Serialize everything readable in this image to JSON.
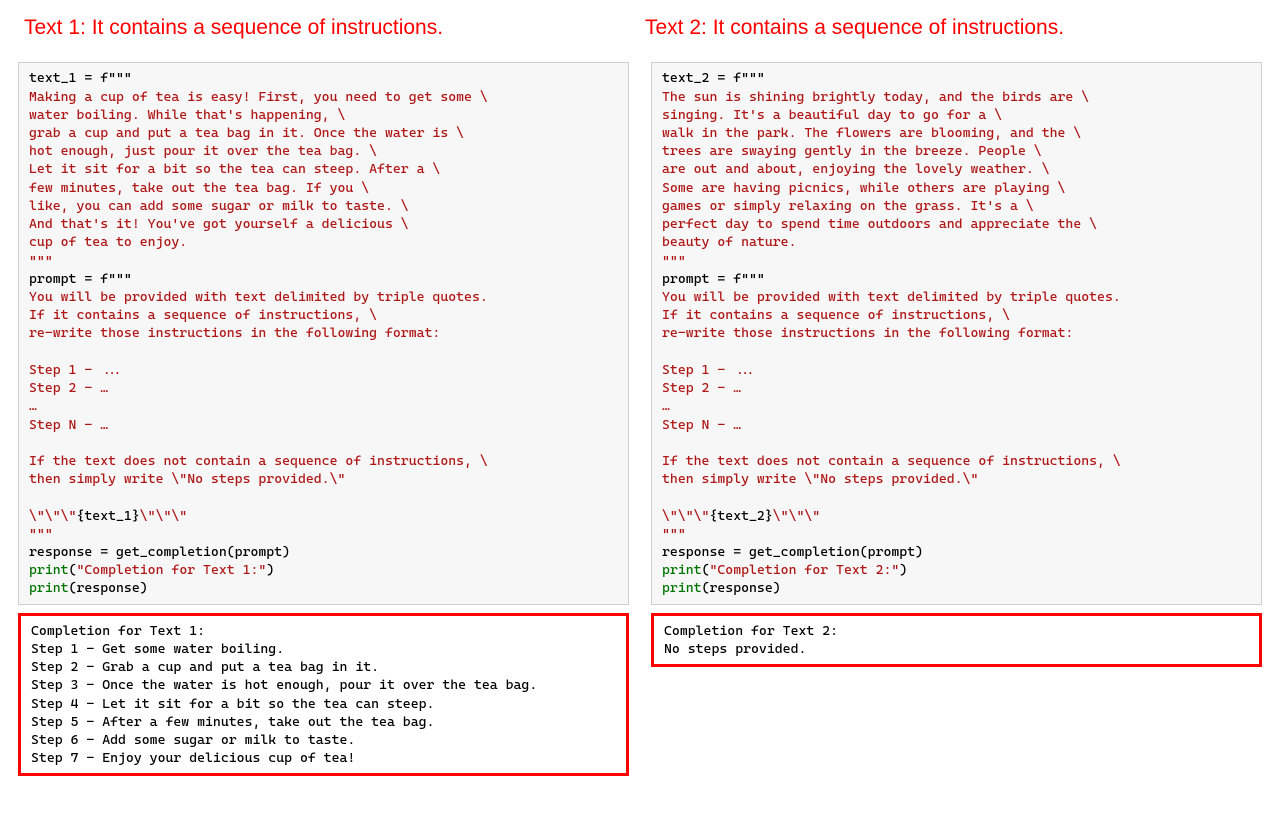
{
  "headers": {
    "left": "Text 1: It contains a sequence of instructions.",
    "right": "Text 2: It contains a sequence of instructions."
  },
  "left": {
    "c0": "text_1 = f\"\"\"",
    "c1": "Making a cup of tea is easy! First, you need to get some \\",
    "c2": "water boiling. While that's happening, \\",
    "c3": "grab a cup and put a tea bag in it. Once the water is \\",
    "c4": "hot enough, just pour it over the tea bag. \\",
    "c5": "Let it sit for a bit so the tea can steep. After a \\",
    "c6": "few minutes, take out the tea bag. If you \\",
    "c7": "like, you can add some sugar or milk to taste. \\",
    "c8": "And that's it! You've got yourself a delicious \\",
    "c9": "cup of tea to enjoy.",
    "c10": "\"\"\"",
    "p0": "prompt = f\"\"\"",
    "p1": "You will be provided with text delimited by triple quotes.",
    "p2": "If it contains a sequence of instructions, \\",
    "p3": "re-write those instructions in the following format:",
    "p4": "",
    "p5": "Step 1 - ...",
    "p6": "Step 2 - …",
    "p7": "…",
    "p8": "Step N - …",
    "p9": "",
    "p10": "If the text does not contain a sequence of instructions, \\",
    "p11": "then simply write \\\"No steps provided.\\\"",
    "p12": "",
    "p13a": "\\\"\\\"\\\"",
    "p13b": "{text_1}",
    "p13c": "\\\"\\\"\\\"",
    "p14": "\"\"\"",
    "r0": "response = get_completion(prompt)",
    "r1a": "print",
    "r1b": "(",
    "r1c": "\"Completion for Text 1:\"",
    "r1d": ")",
    "r2a": "print",
    "r2b": "(response)",
    "out": "Completion for Text 1:\nStep 1 - Get some water boiling.\nStep 2 - Grab a cup and put a tea bag in it.\nStep 3 - Once the water is hot enough, pour it over the tea bag.\nStep 4 - Let it sit for a bit so the tea can steep.\nStep 5 - After a few minutes, take out the tea bag.\nStep 6 - Add some sugar or milk to taste.\nStep 7 - Enjoy your delicious cup of tea!"
  },
  "right": {
    "c0": "text_2 = f\"\"\"",
    "c1": "The sun is shining brightly today, and the birds are \\",
    "c2": "singing. It's a beautiful day to go for a \\",
    "c3": "walk in the park. The flowers are blooming, and the \\",
    "c4": "trees are swaying gently in the breeze. People \\",
    "c5": "are out and about, enjoying the lovely weather. \\",
    "c6": "Some are having picnics, while others are playing \\",
    "c7": "games or simply relaxing on the grass. It's a \\",
    "c8": "perfect day to spend time outdoors and appreciate the \\",
    "c9": "beauty of nature.",
    "c10": "\"\"\"",
    "p0": "prompt = f\"\"\"",
    "p1": "You will be provided with text delimited by triple quotes.",
    "p2": "If it contains a sequence of instructions, \\",
    "p3": "re-write those instructions in the following format:",
    "p4": "",
    "p5": "Step 1 - ...",
    "p6": "Step 2 - …",
    "p7": "…",
    "p8": "Step N - …",
    "p9": "",
    "p10": "If the text does not contain a sequence of instructions, \\",
    "p11": "then simply write \\\"No steps provided.\\\"",
    "p12": "",
    "p13a": "\\\"\\\"\\\"",
    "p13b": "{text_2}",
    "p13c": "\\\"\\\"\\\"",
    "p14": "\"\"\"",
    "r0": "response = get_completion(prompt)",
    "r1a": "print",
    "r1b": "(",
    "r1c": "\"Completion for Text 2:\"",
    "r1d": ")",
    "r2a": "print",
    "r2b": "(response)",
    "out": "Completion for Text 2:\nNo steps provided."
  }
}
